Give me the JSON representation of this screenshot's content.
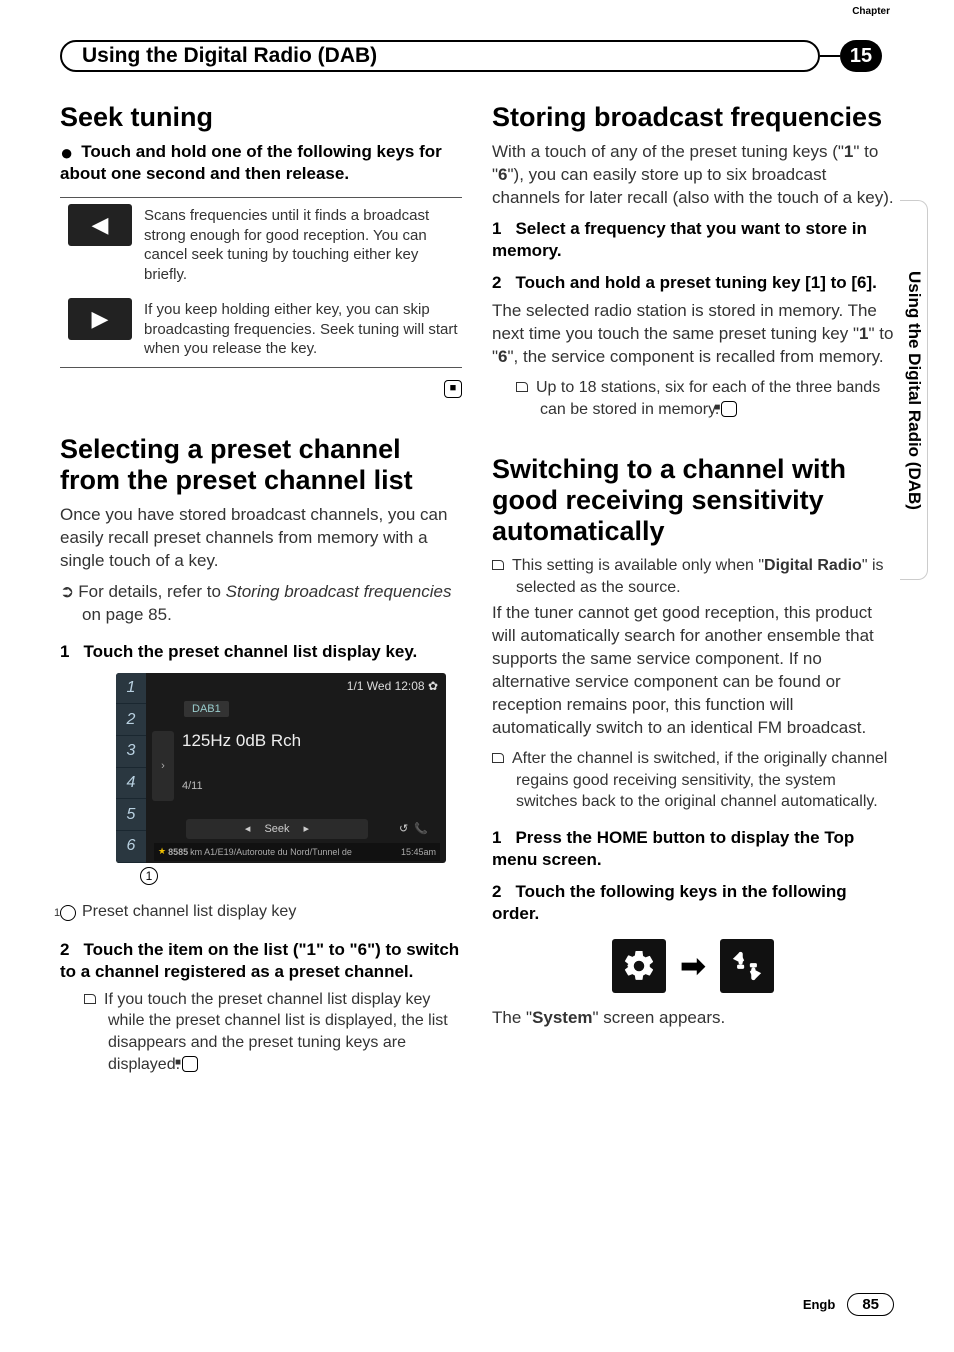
{
  "header": {
    "chapter_label": "Chapter",
    "chapter_num": "15",
    "title": "Using the Digital Radio (DAB)"
  },
  "side_tab": "Using the Digital Radio (DAB)",
  "left": {
    "h1_seek": "Seek tuning",
    "seek_intro": "Touch and hold one of the following keys for about one second and then release.",
    "row1": "Scans frequencies until it finds a broadcast strong enough for good reception. You can cancel seek tuning by touching either key briefly.",
    "row2": "If you keep holding either key, you can skip broadcasting frequencies. Seek tuning will start when you release the key.",
    "h1_select": "Selecting a preset channel from the preset channel list",
    "select_p": "Once you have stored broadcast channels, you can easily recall preset channels from memory with a single touch of a key.",
    "select_ref_pre": "For details, refer to ",
    "select_ref_em": "Storing broadcast frequencies",
    "select_ref_post": " on page 85.",
    "step1": "Touch the preset channel list display key.",
    "ss": {
      "time": "1/1 Wed 12:08",
      "dab": "DAB1",
      "freq": "125Hz 0dB Rch",
      "count": "4/11",
      "seek": "Seek",
      "bottom_km": "8585",
      "bottom_txt": "km A1/E19/Autoroute du Nord/Tunnel de",
      "bottom_time": "15:45am"
    },
    "callout1": "Preset channel list display key",
    "step2": "Touch the item on the list (\"1\" to \"6\") to switch to a channel registered as a preset channel.",
    "note2": "If you touch the preset channel list display key while the preset channel list is displayed, the list disappears and the preset tuning keys are displayed."
  },
  "right": {
    "h1_store": "Storing broadcast frequencies",
    "store_p_pre": "With a touch of any of the preset tuning keys (\"",
    "store_p_b1": "1",
    "store_p_mid": "\" to \"",
    "store_p_b6": "6",
    "store_p_post": "\"), you can easily store up to six broadcast channels for later recall (also with the touch of a key).",
    "store_s1": "Select a frequency that you want to store in memory.",
    "store_s2": "Touch and hold a preset tuning key [1] to [6].",
    "store_body_pre": "The selected radio station is stored in memory. The next time you touch the same preset tuning key \"",
    "store_body_b1": "1",
    "store_body_mid": "\" to \"",
    "store_body_b6": "6",
    "store_body_post": "\", the service component is recalled from memory.",
    "store_note": "Up to 18 stations, six for each of the three bands can be stored in memory.",
    "h1_switch": "Switching to a channel with good receiving sensitivity automatically",
    "switch_note1_pre": "This setting is available only when \"",
    "switch_note1_b": "Digital Radio",
    "switch_note1_post": "\" is selected as the source.",
    "switch_body": "If the tuner cannot get good reception, this product will automatically search for another ensemble that supports the same service component. If no alternative service component can be found or reception remains poor, this function will automatically switch to an identical FM broadcast.",
    "switch_note2": "After the channel is switched, if the originally channel regains good receiving sensitivity, the system switches back to the original channel automatically.",
    "switch_s1": "Press the HOME button to display the Top menu screen.",
    "switch_s2": "Touch the following keys in the following order.",
    "system_pre": "The \"",
    "system_b": "System",
    "system_post": "\" screen appears."
  },
  "footer": {
    "lang": "Engb",
    "page": "85"
  }
}
